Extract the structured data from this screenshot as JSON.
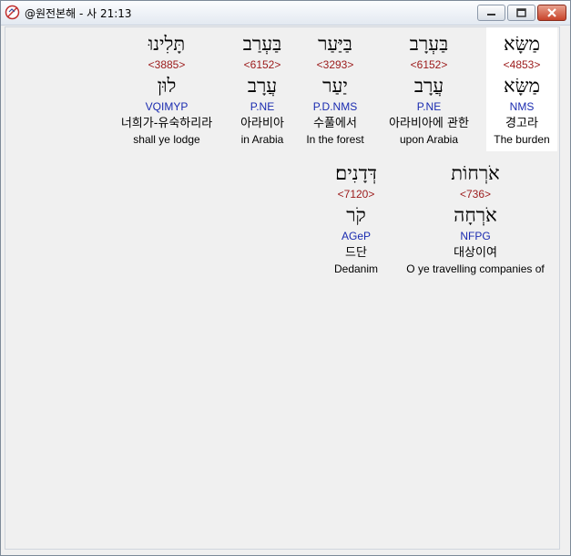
{
  "window": {
    "title": "@원전본해 - 사 21:13"
  },
  "row1": [
    {
      "hebrew": "מַשָּׂא",
      "strong": "<4853>",
      "root": "מַשָּׂא",
      "parsing": "NMS",
      "korean": "경고라",
      "english": "The burden"
    },
    {
      "hebrew": "בַּעְרָב",
      "strong": "<6152>",
      "root": "עֲרָב",
      "parsing": "P.NE",
      "korean": "아라비아에 관한",
      "english": "upon Arabia"
    },
    {
      "hebrew": "בַּיַּעַר",
      "strong": "<3293>",
      "root": "יַעַר",
      "parsing": "P.D.NMS",
      "korean": "수풀에서",
      "english": "In the forest"
    },
    {
      "hebrew": "בַּעְרַב",
      "strong": "<6152>",
      "root": "עֲרָב",
      "parsing": "P.NE",
      "korean": "아라비아",
      "english": "in Arabia"
    },
    {
      "hebrew": "תָּלִינוּ",
      "strong": "<3885>",
      "root": "לוּן",
      "parsing": "VQIMYP",
      "korean": "너희가-유숙하리라",
      "english": "shall ye lodge"
    }
  ],
  "row2": [
    {
      "hebrew": "אֹרְחוֹת",
      "strong": "<736>",
      "root": "אֹרְחָה",
      "parsing": "NFPG",
      "korean": "대상이여",
      "english": "O ye travelling companies of"
    },
    {
      "hebrew": "דְּדָנִים׃",
      "strong": "<7120>",
      "root": "קֹר",
      "parsing": "AGeP",
      "korean": "드단",
      "english": "Dedanim"
    }
  ]
}
